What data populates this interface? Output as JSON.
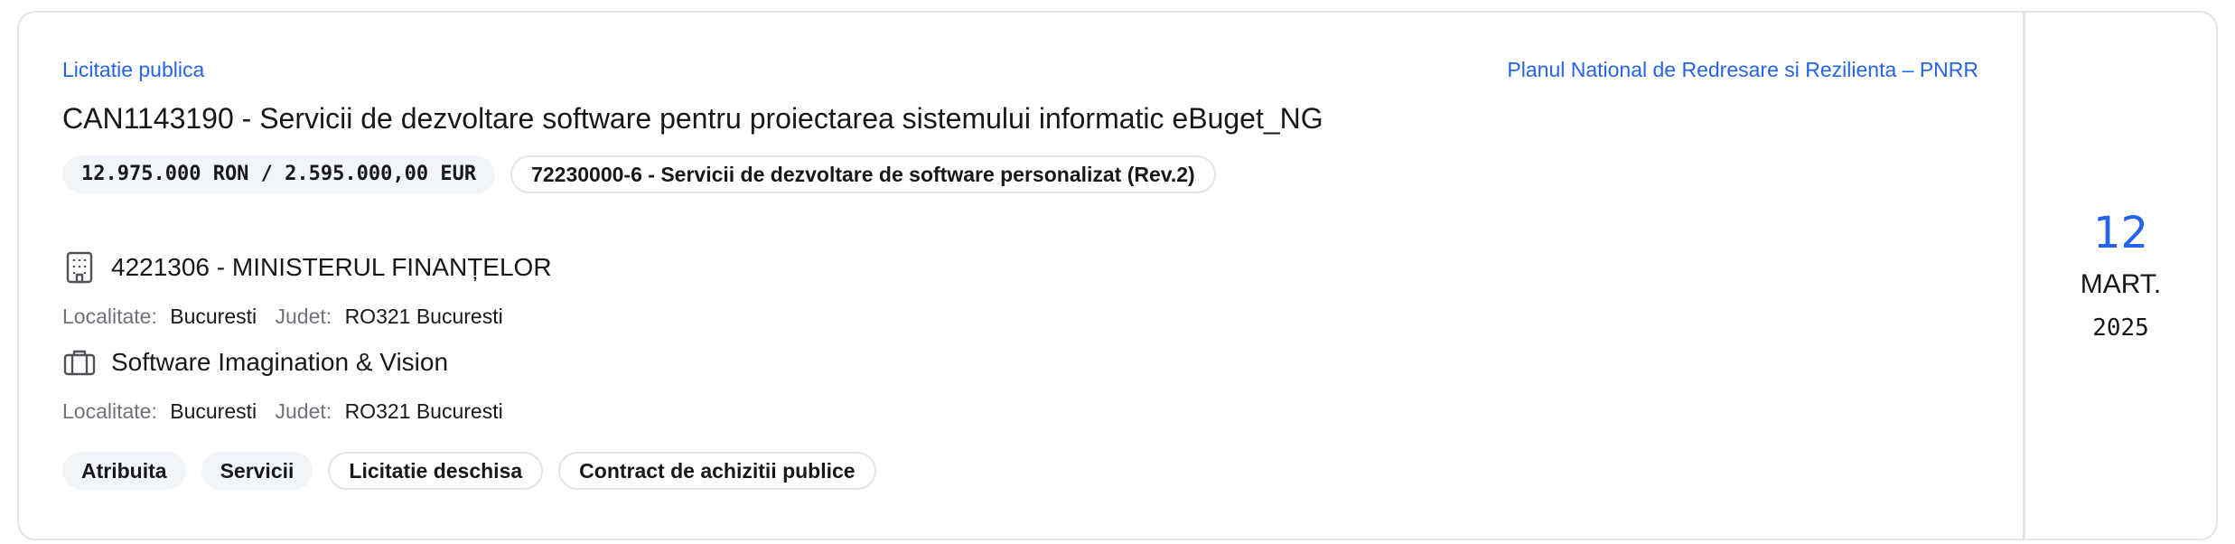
{
  "procedure_type": "Licitatie publica",
  "program": "Planul National de Redresare si Rezilienta – PNRR",
  "title": "CAN1143190 - Servicii de dezvoltare software pentru proiectarea sistemului informatic eBuget_NG",
  "value": "12.975.000 RON / 2.595.000,00 EUR",
  "cpv": "72230000-6 - Servicii de dezvoltare de software personalizat (Rev.2)",
  "authority": {
    "name": "4221306 - MINISTERUL FINANȚELOR",
    "locality_label": "Localitate:",
    "locality": "Bucuresti",
    "county_label": "Judet:",
    "county": "RO321 Bucuresti"
  },
  "winner": {
    "name": "Software Imagination & Vision",
    "locality_label": "Localitate:",
    "locality": "Bucuresti",
    "county_label": "Judet:",
    "county": "RO321 Bucuresti"
  },
  "tags": [
    "Atribuita",
    "Servicii",
    "Licitatie deschisa",
    "Contract de achizitii publice"
  ],
  "date": {
    "day": "12",
    "month": "MART.",
    "year": "2025"
  },
  "icons": {
    "authority": "building-icon",
    "winner": "briefcase-icon"
  },
  "colors": {
    "accent": "#2563eb",
    "chip_bg": "#f1f5f9",
    "border": "#e4e4e7",
    "muted": "#71717a"
  }
}
